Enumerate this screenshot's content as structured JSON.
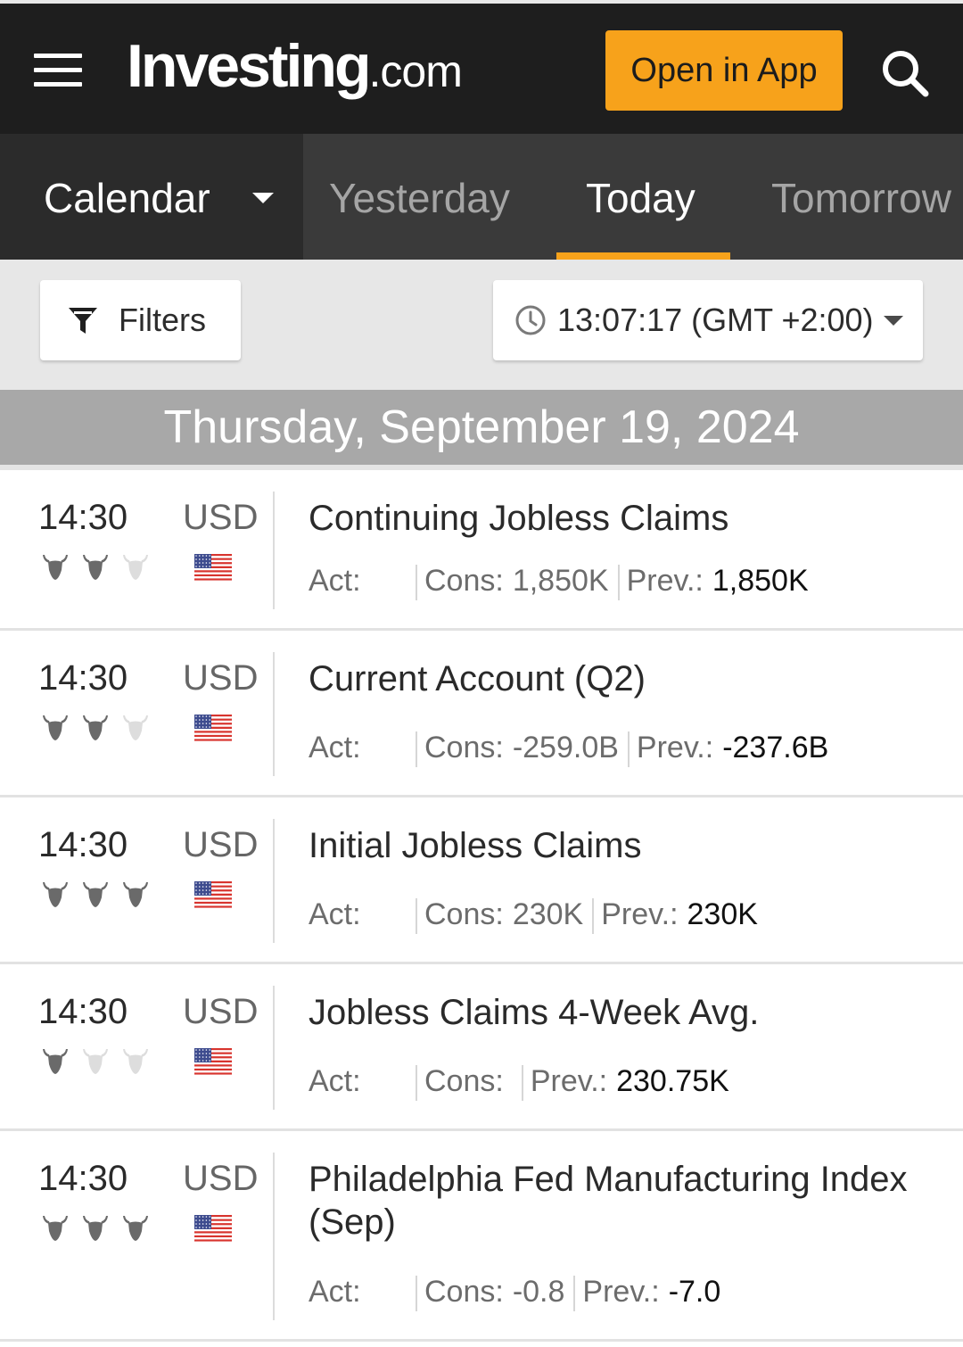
{
  "header": {
    "logo_brand": "Investing",
    "logo_tld": ".com",
    "open_app_label": "Open in App",
    "colors": {
      "background": "#1e1e1e",
      "accent": "#f7a21b"
    }
  },
  "tabs": {
    "section_label": "Calendar",
    "items": [
      {
        "label": "Yesterday",
        "active": false
      },
      {
        "label": "Today",
        "active": true
      },
      {
        "label": "Tomorrow",
        "active": false
      }
    ]
  },
  "toolbar": {
    "filters_label": "Filters",
    "time_label": "13:07:17 (GMT +2:00)"
  },
  "date_header": "Thursday, September 19, 2024",
  "events": [
    {
      "time": "14:30",
      "currency": "USD",
      "importance": 2,
      "title": "Continuing Jobless Claims",
      "act_label": "Act:",
      "act_value": "",
      "cons_label": "Cons:",
      "cons_value": "1,850K",
      "prev_label": "Prev.:",
      "prev_value": "1,850K"
    },
    {
      "time": "14:30",
      "currency": "USD",
      "importance": 2,
      "title": "Current Account (Q2)",
      "act_label": "Act:",
      "act_value": "",
      "cons_label": "Cons:",
      "cons_value": "-259.0B",
      "prev_label": "Prev.:",
      "prev_value": "-237.6B"
    },
    {
      "time": "14:30",
      "currency": "USD",
      "importance": 3,
      "title": "Initial Jobless Claims",
      "act_label": "Act:",
      "act_value": "",
      "cons_label": "Cons:",
      "cons_value": "230K",
      "prev_label": "Prev.:",
      "prev_value": "230K"
    },
    {
      "time": "14:30",
      "currency": "USD",
      "importance": 1,
      "title": "Jobless Claims 4-Week Avg.",
      "act_label": "Act:",
      "act_value": "",
      "cons_label": "Cons:",
      "cons_value": "",
      "prev_label": "Prev.:",
      "prev_value": "230.75K"
    },
    {
      "time": "14:30",
      "currency": "USD",
      "importance": 3,
      "title": "Philadelphia Fed Manufacturing Index (Sep)",
      "act_label": "Act:",
      "act_value": "",
      "cons_label": "Cons:",
      "cons_value": "-0.8",
      "prev_label": "Prev.:",
      "prev_value": "-7.0"
    }
  ],
  "icons": {
    "menu": "hamburger-menu-icon",
    "search": "search-icon",
    "dropdown": "chevron-down-icon",
    "filter": "funnel-icon",
    "clock": "clock-icon",
    "importance": "bull-icon",
    "flag": "us-flag-icon"
  }
}
